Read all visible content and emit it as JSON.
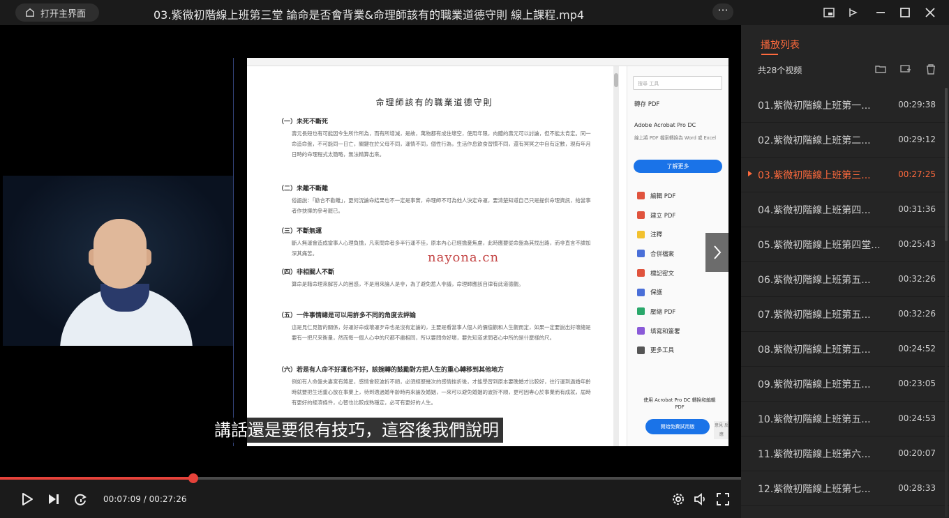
{
  "window": {
    "title": "03.紫微初階線上班第三堂  論命是否會背業&命理師該有的職業道德守則  線上課程.mp4",
    "home_label": "打开主界面",
    "more_label": "···"
  },
  "document": {
    "title": "命理師該有的職業道德守則",
    "sections": [
      {
        "heading": "（一）未死不斷死",
        "body": "壽元長短也有可能因今生所作所為，而有所增減，是故，萬物都有成住壞空，使用年限，肉體的壽元可以討論，但不能太肯定。同一命造命盤，不可能同一日亡，關鍵在於父母不同，運情不同，個性行為，生活作息飲食習慣不同，還有冥冥之中自有定數，現有年月日時的命理程式太簡略，無法精算出來。"
      },
      {
        "heading": "（二）未離不斷離",
        "body": "俗語說：「勸合不勸離」，更何況論命結果也不一定是事實，命理師不可為他人決定命運，要清楚知道自己只是提供命理資訊，給當事者作抉擇的參考罷已。"
      },
      {
        "heading": "（三）不斷無運",
        "body": "斷人無運會造成當事人心理負擔，凡來問命者多半行運不佳，原本內心已經擔憂焦慮，此時應要從命盤為其找出路，而非直言不諱加深其痛苦。"
      },
      {
        "heading": "（四）非相關人不斷",
        "body": "算命是藉命理來解答人的困惑，不是用來論人是非，為了避免惹人非議，命理師應該自律有此道德觀。"
      },
      {
        "heading": "（五）一件事情總是可以用許多不同的角度去評論",
        "body": "這是見仁見智的關係，好運好命或壞運歹命也是沒有定論的，主要是看當事人個人的價值觀和人生觀而定，如果一定要說出好壞總是要有一把尺來衡量，然而每一個人心中的尺都不盡相同，所以要問命好壞，要先知道求問者心中所的是什麼樣的尺。"
      },
      {
        "heading": "（六）若是有人命不好運也不好，該婉轉的鼓勵對方把人生的重心轉移到其他地方",
        "body": "例如有人命盤夫妻宮有煞星，感情會較波折不順，必須經歷幾次的感情挫折後，才能學習到原本要晚婚才比較好，往行運到過婚年齡時就要把生活重心放在事業上，待到適過婚年齡時再來論及婚姻，一來可以避免婚姻的波折不順，更可因專心於事業而有成就，屆時有更好的經濟條件，心智也比較成熟穩定，必可有更好的人生。"
      }
    ],
    "search_placeholder": "搜尋 工具",
    "export_label": "轉存 PDF",
    "product_name": "Adobe Acrobat Pro DC",
    "product_desc": "線上將 PDF 檔案轉換為 Word 或 Excel",
    "learn_more": "了解更多",
    "tools": [
      {
        "label": "編輯 PDF",
        "color": "#e0533d"
      },
      {
        "label": "建立 PDF",
        "color": "#e0533d"
      },
      {
        "label": "注釋",
        "color": "#f2c12e"
      },
      {
        "label": "合併檔案",
        "color": "#4a6fd8"
      },
      {
        "label": "標記密文",
        "color": "#e0533d"
      },
      {
        "label": "保護",
        "color": "#4a6fd8"
      },
      {
        "label": "壓縮 PDF",
        "color": "#2aa86b"
      },
      {
        "label": "填寫和簽署",
        "color": "#8a5ad8"
      },
      {
        "label": "更多工具",
        "color": "#555555"
      }
    ],
    "promo_text": "使用 Acrobat Pro DC 轉換和編輯 PDF",
    "promo_button": "開始免費試用版",
    "feedback_label": "意見 反應"
  },
  "watermark": "nayona.cn",
  "subtitle": "講話還是要很有技巧，這容後我們說明",
  "player": {
    "current_time": "00:07:09",
    "total_time": "00:27:26",
    "time_separator": " / ",
    "progress": 0.261,
    "accent_color": "#e5423a"
  },
  "playlist": {
    "tab_label": "播放列表",
    "count_label": "共28个视频",
    "accent_color": "#ff6a3d",
    "items": [
      {
        "name": "01.紫微初階線上班第一...",
        "duration": "00:29:38"
      },
      {
        "name": "02.紫微初階線上班第二...",
        "duration": "00:29:12"
      },
      {
        "name": "03.紫微初階線上班第三...",
        "duration": "00:27:25"
      },
      {
        "name": "04.紫微初階線上班第四...",
        "duration": "00:31:36"
      },
      {
        "name": "05.紫微初階線上班第四堂...",
        "duration": "00:25:43"
      },
      {
        "name": "06.紫微初階線上班第五...",
        "duration": "00:32:26"
      },
      {
        "name": "07.紫微初階線上班第五...",
        "duration": "00:32:26"
      },
      {
        "name": "08.紫微初階線上班第五...",
        "duration": "00:24:52"
      },
      {
        "name": "09.紫微初階線上班第五...",
        "duration": "00:23:05"
      },
      {
        "name": "10.紫微初階線上班第五...",
        "duration": "00:24:53"
      },
      {
        "name": "11.紫微初階線上班第六...",
        "duration": "00:20:07"
      },
      {
        "name": "12.紫微初階線上班第七...",
        "duration": "00:28:33"
      }
    ]
  }
}
